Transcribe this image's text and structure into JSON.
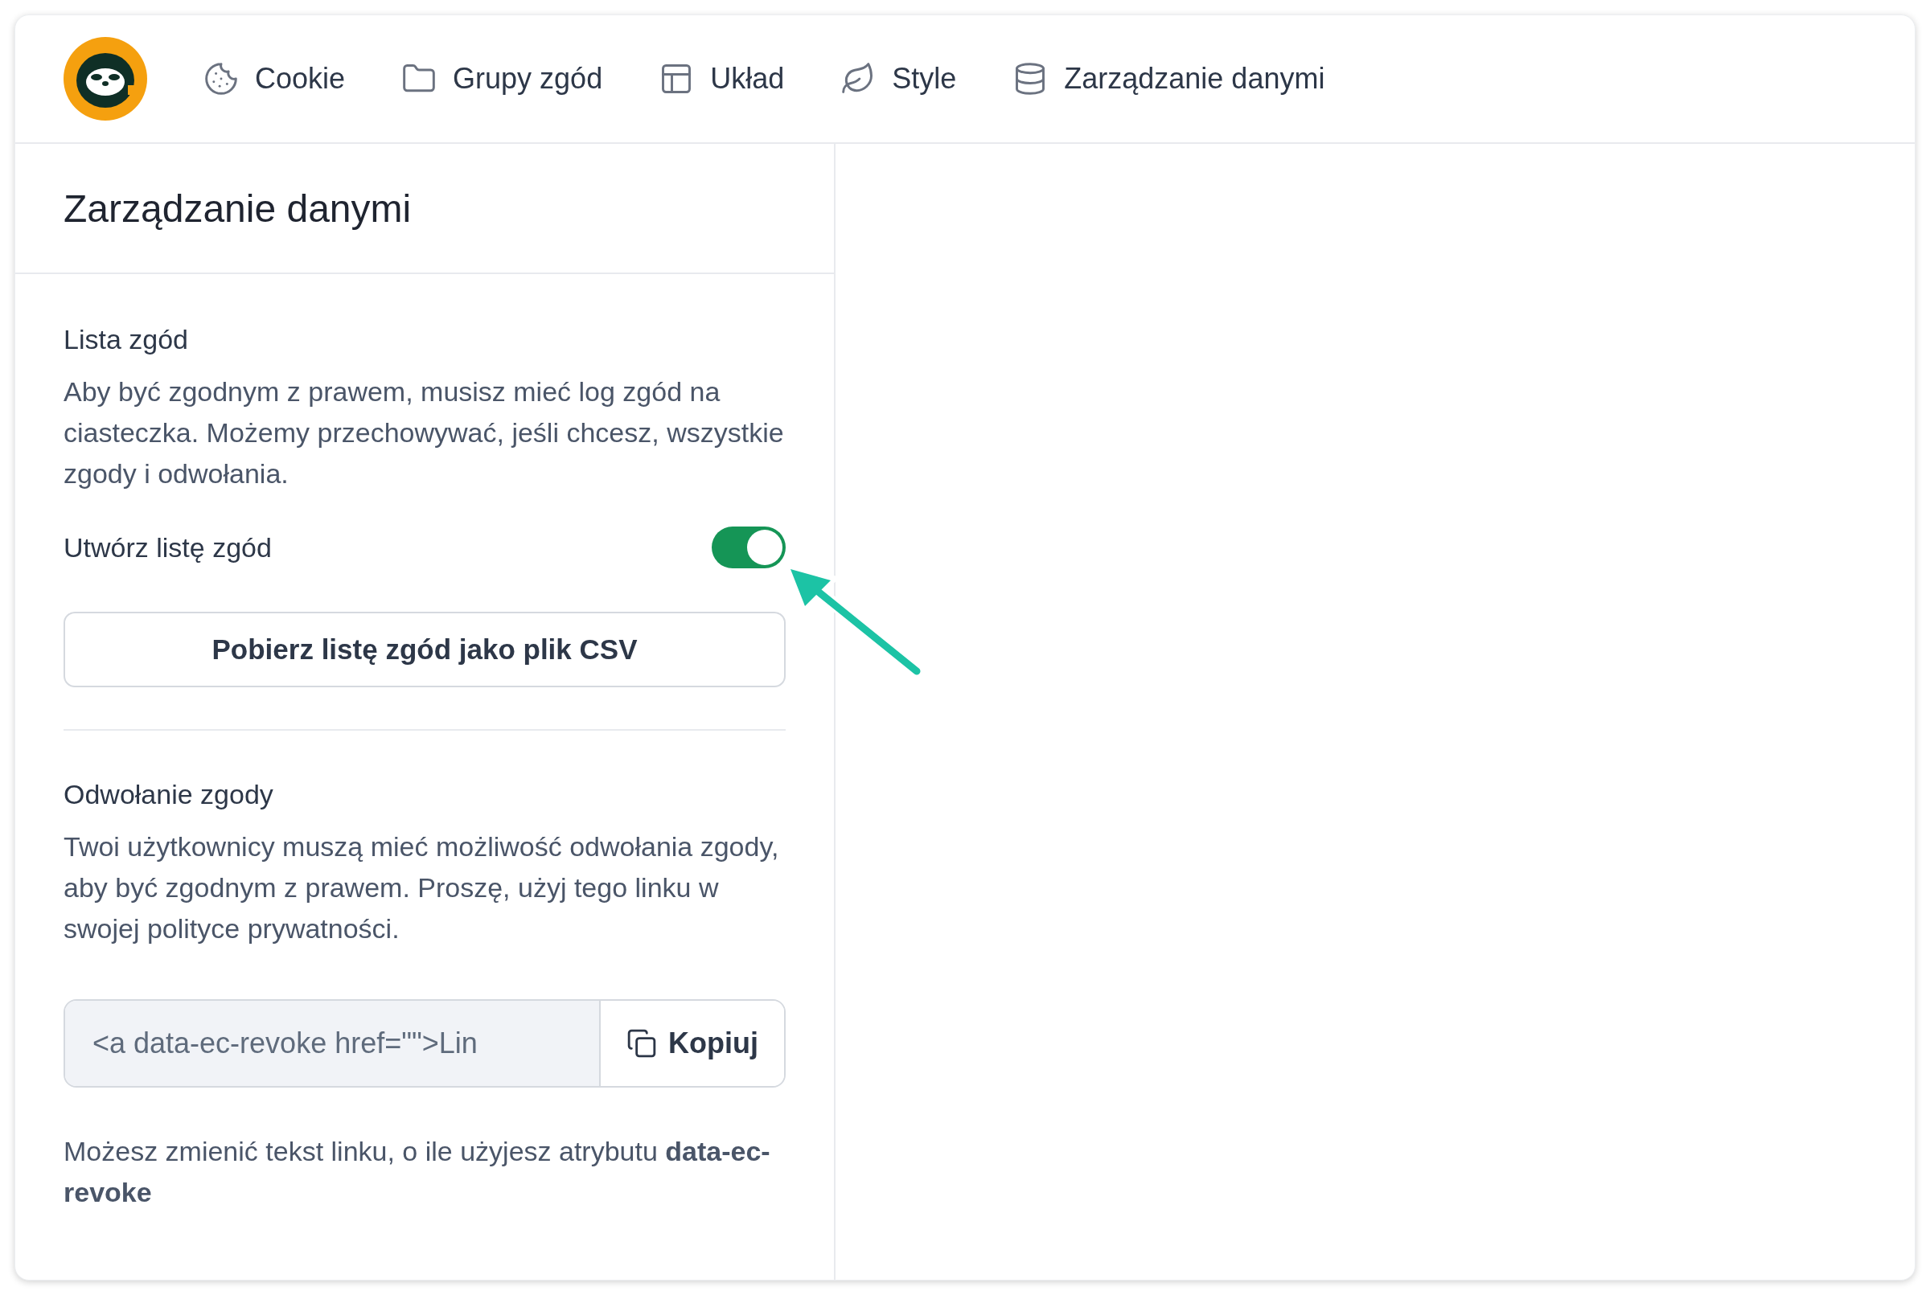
{
  "nav": [
    {
      "kind": "cookie",
      "label": "Cookie"
    },
    {
      "kind": "folder",
      "label": "Grupy zgód"
    },
    {
      "kind": "layout",
      "label": "Układ"
    },
    {
      "kind": "leaf",
      "label": "Style"
    },
    {
      "kind": "database",
      "label": "Zarządzanie danymi"
    }
  ],
  "panel": {
    "title": "Zarządzanie danymi",
    "consent_list": {
      "heading": "Lista zgód",
      "description": "Aby być zgodnym z prawem, musisz mieć log zgód na ciasteczka. Możemy przechowywać, jeśli chcesz, wszystkie zgody i odwołania.",
      "toggle_label": "Utwórz listę zgód",
      "toggle_on": true,
      "download_button": "Pobierz listę zgód jako plik CSV"
    },
    "revoke": {
      "heading": "Odwołanie zgody",
      "description": "Twoi użytkownicy muszą mieć możliwość odwołania zgody, aby być zgodnym z prawem. Proszę, użyj tego linku w swojej polityce prywatności.",
      "code_value": "<a data-ec-revoke href=\"\">Lin",
      "copy_button": "Kopiuj",
      "note": "Możesz zmienić tekst linku, o ile użyjesz atrybutu **data-ec-revoke**"
    }
  }
}
